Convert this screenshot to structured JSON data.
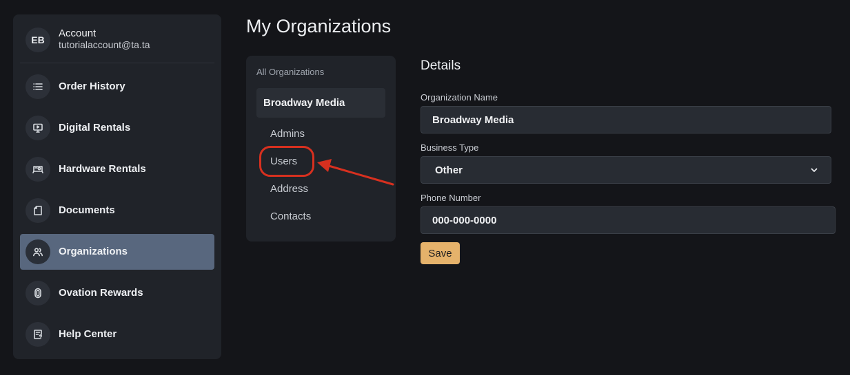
{
  "account": {
    "initials": "EB",
    "label": "Account",
    "email": "tutorialaccount@ta.ta"
  },
  "sidebar": {
    "items": [
      {
        "label": "Order History",
        "icon": "list-icon"
      },
      {
        "label": "Digital Rentals",
        "icon": "monitor-play-icon"
      },
      {
        "label": "Hardware Rentals",
        "icon": "hardware-icon"
      },
      {
        "label": "Documents",
        "icon": "document-icon"
      },
      {
        "label": "Organizations",
        "icon": "users-icon",
        "active": true
      },
      {
        "label": "Ovation Rewards",
        "icon": "rewards-icon"
      },
      {
        "label": "Help Center",
        "icon": "help-doc-icon"
      }
    ]
  },
  "page": {
    "title": "My Organizations"
  },
  "orgs": {
    "heading": "All Organizations",
    "selected": "Broadway Media",
    "subitems": [
      "Admins",
      "Users",
      "Address",
      "Contacts"
    ]
  },
  "details": {
    "title": "Details",
    "org_name_label": "Organization Name",
    "org_name_value": "Broadway Media",
    "business_type_label": "Business Type",
    "business_type_value": "Other",
    "phone_label": "Phone Number",
    "phone_value": "000-000-0000",
    "save_label": "Save"
  },
  "colors": {
    "accent": "#e5b26b",
    "active_nav": "#58677e",
    "annotation": "#d7301f"
  }
}
